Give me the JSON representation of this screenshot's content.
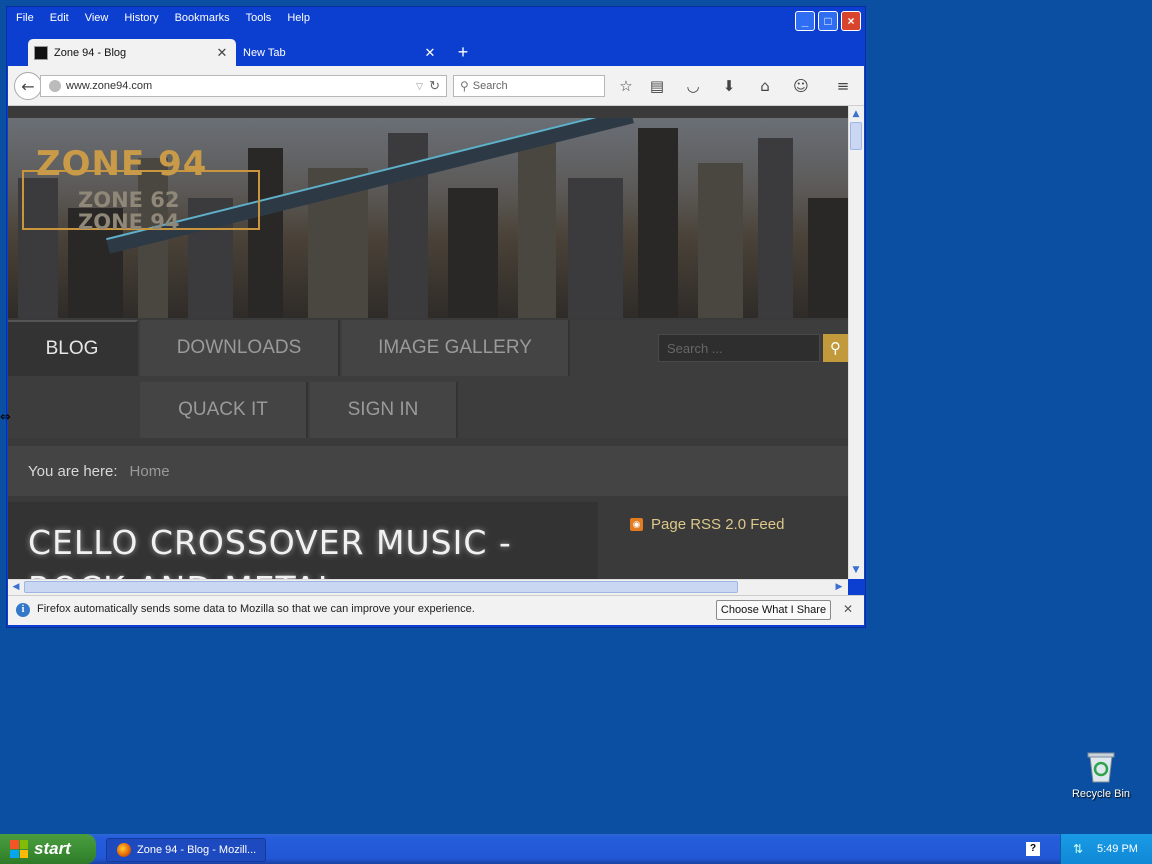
{
  "window": {
    "menu": [
      "File",
      "Edit",
      "View",
      "History",
      "Bookmarks",
      "Tools",
      "Help"
    ],
    "controls": {
      "minimize": "_",
      "maximize": "□",
      "close": "×"
    }
  },
  "tabs": [
    {
      "label": "Zone 94 - Blog",
      "active": true
    },
    {
      "label": "New Tab",
      "active": false
    }
  ],
  "navbar": {
    "url": "www.zone94.com",
    "search_placeholder": "Search",
    "tools": [
      "bookmark-star-icon",
      "reading-list-icon",
      "pocket-icon",
      "download-icon",
      "home-icon",
      "hello-chat-icon",
      "hamburger-menu-icon"
    ]
  },
  "page": {
    "logo_main": "ZONE 94",
    "logo_sub1": "ZONE 62",
    "logo_sub2": "ZONE 94",
    "nav": [
      "BLOG",
      "DOWNLOADS",
      "IMAGE GALLERY",
      "QUACK IT",
      "SIGN IN"
    ],
    "search_placeholder": "Search ...",
    "breadcrumb_label": "You are here:",
    "breadcrumb_home": "Home",
    "article_title": "CELLO CROSSOVER MUSIC - ROCK AND METAL",
    "rss_label": "Page RSS 2.0 Feed"
  },
  "notification": {
    "text": "Firefox automatically sends some data to Mozilla so that we can improve your experience.",
    "button": "Choose What I Share"
  },
  "desktop": {
    "recycle_label": "Recycle Bin"
  },
  "taskbar": {
    "start": "start",
    "item": "Zone 94 - Blog - Mozill...",
    "clock": "5:49 PM"
  },
  "colors": {
    "desktop": "#0a4fa1",
    "titlebar": "#0c3fd0",
    "accent_gold": "#c29a3c",
    "rss_orange": "#e37b20"
  }
}
